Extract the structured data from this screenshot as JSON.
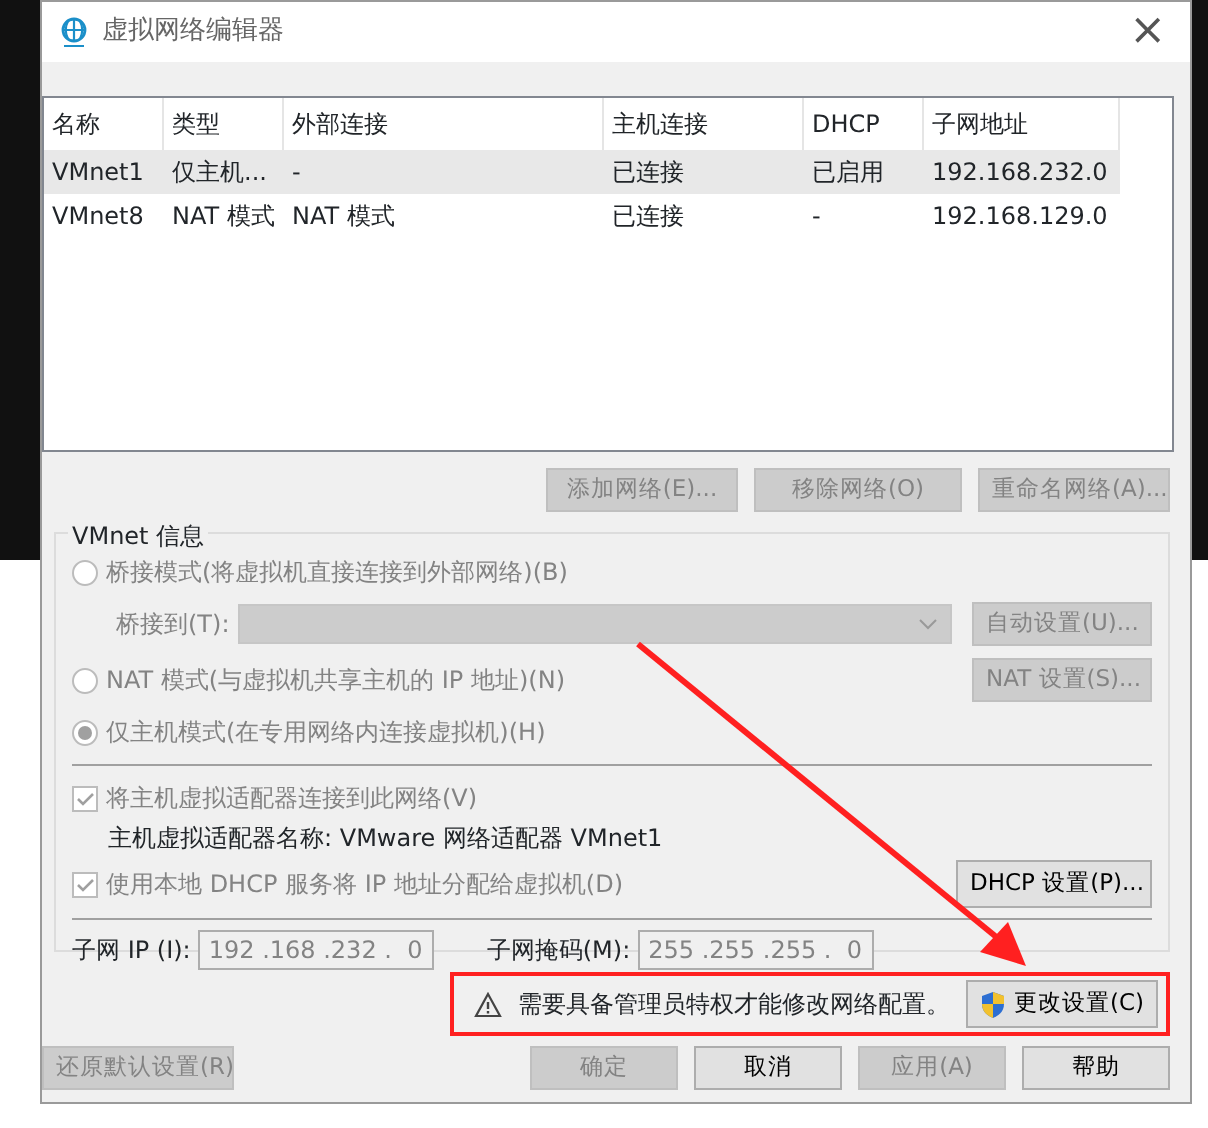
{
  "window": {
    "title": "虚拟网络编辑器",
    "close": "×"
  },
  "table": {
    "columns": [
      "名称",
      "类型",
      "外部连接",
      "主机连接",
      "DHCP",
      "子网地址"
    ],
    "rows": [
      {
        "cells": [
          "VMnet1",
          "仅主机...",
          "-",
          "已连接",
          "已启用",
          "192.168.232.0"
        ],
        "selected": true
      },
      {
        "cells": [
          "VMnet8",
          "NAT 模式",
          "NAT 模式",
          "已连接",
          "-",
          "192.168.129.0"
        ],
        "selected": false
      }
    ]
  },
  "list_buttons": [
    {
      "label": "添加网络(E)...",
      "disabled": true
    },
    {
      "label": "移除网络(O)",
      "disabled": true
    },
    {
      "label": "重命名网络(A)...",
      "disabled": true
    }
  ],
  "vmnet_info": {
    "title": "VMnet 信息",
    "modes": [
      {
        "label": "桥接模式(将虚拟机直接连接到外部网络)(B)",
        "selected": false,
        "disabled": true
      },
      {
        "label": "NAT 模式(与虚拟机共享主机的 IP 地址)(N)",
        "selected": false,
        "disabled": true,
        "button": {
          "label": "NAT 设置(S)...",
          "disabled": true
        }
      },
      {
        "label": "仅主机模式(在专用网络内连接虚拟机)(H)",
        "selected": true,
        "disabled": true
      }
    ],
    "bridge_to": {
      "label": "桥接到(T):",
      "disabled": true,
      "button": {
        "label": "自动设置(U)...",
        "disabled": true
      }
    },
    "connect_adapter": {
      "label": "将主机虚拟适配器连接到此网络(V)",
      "checked": true,
      "disabled": true
    },
    "adapter_name": "主机虚拟适配器名称: VMware 网络适配器 VMnet1",
    "use_dhcp": {
      "label": "使用本地 DHCP 服务将 IP 地址分配给虚拟机(D)",
      "checked": true,
      "disabled": true
    },
    "dhcp_button": {
      "label": "DHCP 设置(P)...",
      "disabled": false
    },
    "subnet_ip": {
      "label": "子网 IP (I):",
      "value": "192 .168 .232 .  0",
      "disabled": true
    },
    "subnet_mask": {
      "label": "子网掩码(M):",
      "value": "255 .255 .255 .  0",
      "disabled": true
    }
  },
  "admin_notice": {
    "text": "需要具备管理员特权才能修改网络配置。",
    "button": "更改设置(C)"
  },
  "footer_buttons": [
    {
      "label": "还原默认设置(R)",
      "disabled": true
    },
    {
      "label": "确定",
      "disabled": true
    },
    {
      "label": "取消",
      "disabled": false
    },
    {
      "label": "应用(A)",
      "disabled": true
    },
    {
      "label": "帮助",
      "disabled": false
    }
  ],
  "annotations": {
    "highlight_box": true,
    "arrow": true
  }
}
